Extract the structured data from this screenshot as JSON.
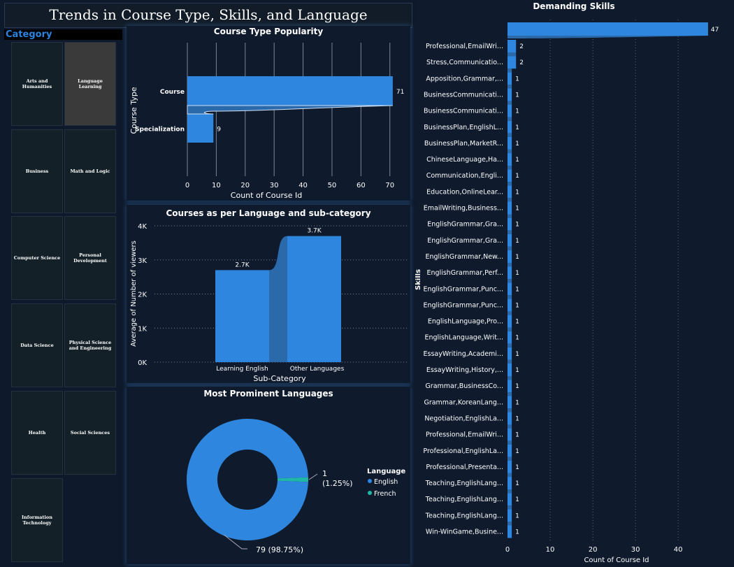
{
  "header": {
    "title": "Trends in Course Type, Skills, and Language Preferences"
  },
  "category": {
    "label": "Category",
    "items": [
      "Arts and Humanities",
      "Language Learning",
      "Business",
      "Math and Logic",
      "Computer Science",
      "Personal Development",
      "Data Science",
      "Physical Science and Engineering",
      "Health",
      "Social Sciences",
      "Information Technology"
    ],
    "selected": "Language Learning"
  },
  "colors": {
    "accent": "#2e86de",
    "teal": "#1fb8a6",
    "background": "#0e1a2b"
  },
  "chart_data": [
    {
      "id": "course_type",
      "type": "bar",
      "orientation": "horizontal",
      "title": "Course Type Popularity",
      "xlabel": "Count of Course Id",
      "ylabel": "Course Type",
      "categories": [
        "Course",
        "Specialization"
      ],
      "values": [
        71,
        9
      ],
      "data_labels": [
        "71",
        "9"
      ],
      "xlim": [
        0,
        72
      ],
      "xticks": [
        "0",
        "10",
        "20",
        "30",
        "40",
        "50",
        "60",
        "70"
      ],
      "grid": true
    },
    {
      "id": "language_subcat",
      "type": "bar",
      "title": "Courses as per Language and sub-category",
      "xlabel": "Sub-Category",
      "ylabel": "Average of Number of viewers",
      "categories": [
        "Learning English",
        "Other Languages"
      ],
      "values": [
        2700,
        3700
      ],
      "data_labels": [
        "2.7K",
        "3.7K"
      ],
      "ylim": [
        0,
        4000
      ],
      "yticks": [
        "0K",
        "1K",
        "2K",
        "3K",
        "4K"
      ],
      "grid": true
    },
    {
      "id": "languages",
      "type": "pie",
      "donut": true,
      "title": "Most Prominent Languages",
      "legend_title": "Language",
      "legend_position": "right",
      "labels": [
        "English",
        "French"
      ],
      "values": [
        79,
        1
      ],
      "data_labels": [
        "79 (98.75%)",
        "1",
        "(1.25%)"
      ]
    },
    {
      "id": "skills",
      "type": "bar",
      "orientation": "horizontal",
      "title": "Demanding Skills",
      "xlabel": "Count of Course Id",
      "ylabel": "Skills",
      "first_value": 47,
      "categories": [
        "Professional,EmailWri...",
        "Stress,Communicatio...",
        "Apposition,Grammar,...",
        "BusinessCommunicati...",
        "BusinessCommunicati...",
        "BusinessPlan,EnglishL...",
        "BusinessPlan,MarketR...",
        "ChineseLanguage,Ha...",
        "Communication,Engli...",
        "Education,OnlineLear...",
        "EmailWriting,Business...",
        "EnglishGrammar,Gra...",
        "EnglishGrammar,Gra...",
        "EnglishGrammar,New...",
        "EnglishGrammar,Perf...",
        "EnglishGrammar,Punc...",
        "EnglishGrammar,Punc...",
        "EnglishLanguage,Pro...",
        "EnglishLanguage,Writ...",
        "EssayWriting,Academi...",
        "EssayWriting,History,...",
        "Grammar,BusinessCo...",
        "Grammar,KoreanLang...",
        "Negotiation,EnglishLa...",
        "Professional,EmailWri...",
        "Professional,EnglishLa...",
        "Professional,Presenta...",
        "Teaching,EnglishLang...",
        "Teaching,EnglishLang...",
        "Teaching,EnglishLang...",
        "Win-WinGame,Busine..."
      ],
      "values": [
        2,
        2,
        1,
        1,
        1,
        1,
        1,
        1,
        1,
        1,
        1,
        1,
        1,
        1,
        1,
        1,
        1,
        1,
        1,
        1,
        1,
        1,
        1,
        1,
        1,
        1,
        1,
        1,
        1,
        1,
        1
      ],
      "xlim": [
        0,
        48
      ],
      "xticks": [
        "0",
        "10",
        "20",
        "30",
        "40"
      ],
      "grid": true
    }
  ]
}
